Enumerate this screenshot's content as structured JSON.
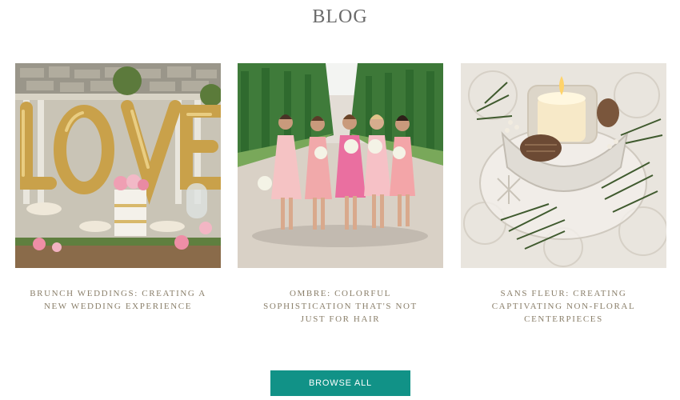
{
  "header": {
    "title": "BLOG"
  },
  "posts": [
    {
      "title": "BRUNCH WEDDINGS: CREATING A NEW WEDDING EXPERIENCE",
      "image": "love-balloons-dessert-table"
    },
    {
      "title": "OMBRE: COLORFUL SOPHISTICATION THAT'S NOT JUST FOR HAIR",
      "image": "bridesmaids-pink-dresses"
    },
    {
      "title": "SANS FLEUR: CREATING CAPTIVATING NON-FLORAL CENTERPIECES",
      "image": "candle-pine-centerpiece"
    }
  ],
  "footer": {
    "browse_label": "BROWSE ALL"
  },
  "colors": {
    "accent": "#119287",
    "title_text": "#8a7f6a",
    "heading": "#6a6a6a"
  }
}
